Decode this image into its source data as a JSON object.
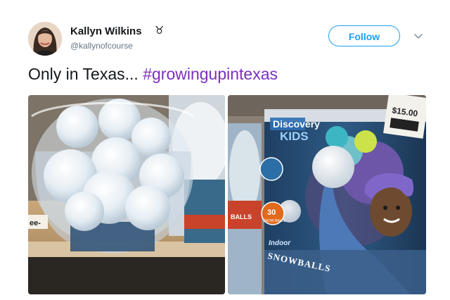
{
  "tweet": {
    "author": {
      "name": "Kallyn Wilkins",
      "emoji": "♉",
      "handle": "@kallynofcourse"
    },
    "follow_label": "Follow",
    "text_plain": "Only in Texas... ",
    "hashtag": "#growingupintexas",
    "colors": {
      "accent": "#1da1f2",
      "hashtag": "#7b2fbf",
      "handle": "#657786"
    }
  },
  "photos": {
    "left": {
      "label_fragment": "ee-"
    },
    "right": {
      "brand_top": "Discovery",
      "brand_bottom": "KIDS",
      "price": "$15.00",
      "count_number": "30",
      "count_text": "SNOW BALLS",
      "indoor": "Indoor",
      "snowballs": "SNOWBALLS",
      "side_label": "BALLS"
    }
  },
  "icons": {
    "chevron": "chevron-down-icon",
    "avatar": "avatar"
  }
}
